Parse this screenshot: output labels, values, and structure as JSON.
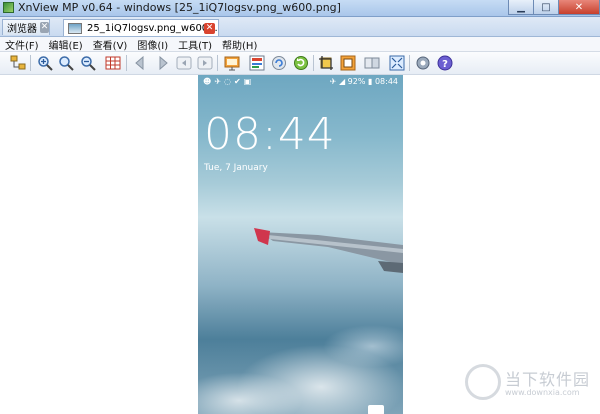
{
  "window": {
    "title": "XnView MP v0.64 - windows [25_1iQ7logsv.png_w600.png]",
    "controls": {
      "minimize": "▁",
      "maximize": "□",
      "close": "✕"
    }
  },
  "tabs": [
    {
      "label": "浏览器",
      "close": "✕"
    },
    {
      "label": "25_1iQ7logsv.png_w600...",
      "close": "✕"
    }
  ],
  "menu": [
    "文件(F)",
    "编辑(E)",
    "查看(V)",
    "图像(I)",
    "工具(T)",
    "帮助(H)"
  ],
  "toolbar_icons": [
    "tree-icon",
    "zoom-in-icon",
    "zoom-fit-icon",
    "zoom-out-icon",
    "grid-icon",
    "back-icon",
    "forward-icon",
    "first-icon",
    "last-icon",
    "slideshow-icon",
    "info-icon",
    "refresh-icon",
    "rotate-icon",
    "crop-icon",
    "resize-icon",
    "compare-icon",
    "fullscreen-icon",
    "settings-icon",
    "help-icon"
  ],
  "phone": {
    "status_right": "✈ ◢ 92% ▮ 08:44",
    "clock": "08:44",
    "date": "Tue, 7 January"
  },
  "watermark": {
    "title": "当下软件园",
    "url": "www.downxia.com"
  },
  "colors": {
    "titlebar": "#a9c6ea",
    "close_button": "#c7402d",
    "tab_close": "#d9432e"
  }
}
